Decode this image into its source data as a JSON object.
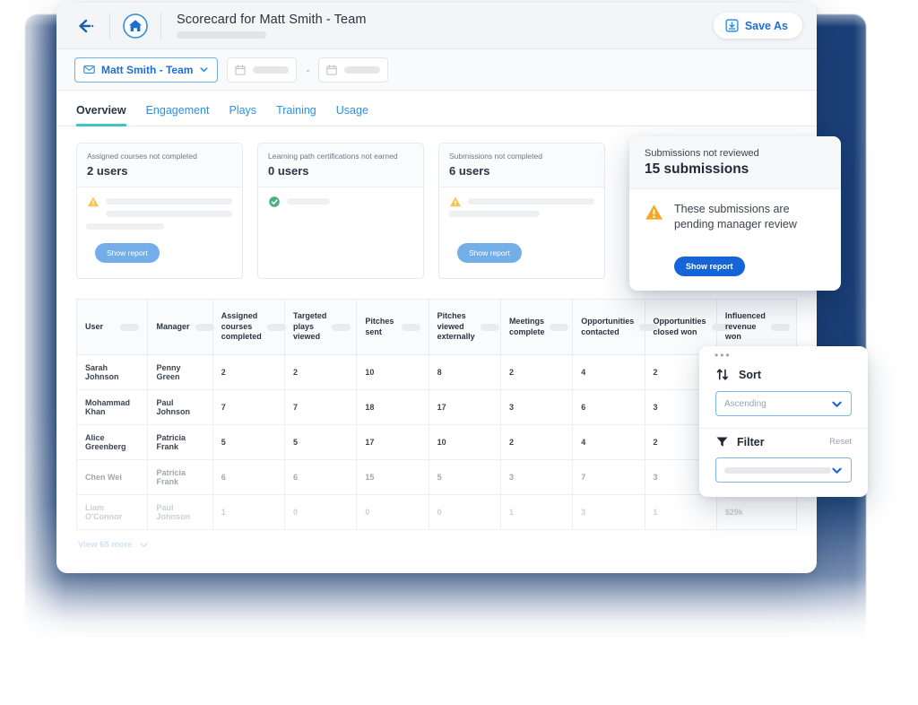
{
  "header": {
    "title": "Scorecard for Matt Smith - Team",
    "back_icon": "arrow-left-icon",
    "home_icon": "home-icon",
    "save_as_label": "Save As",
    "save_as_icon": "save-icon"
  },
  "filter_bar": {
    "audience_chip": {
      "label": "Matt Smith - Team",
      "icon": "envelope-icon",
      "chevron": "chevron-down-icon"
    },
    "date_from": {
      "value": "",
      "icon": "calendar-icon"
    },
    "date_separator": "-",
    "date_to": {
      "value": "",
      "icon": "calendar-icon"
    }
  },
  "tabs": [
    {
      "label": "Overview",
      "active": true
    },
    {
      "label": "Engagement",
      "active": false
    },
    {
      "label": "Plays",
      "active": false
    },
    {
      "label": "Training",
      "active": false
    },
    {
      "label": "Usage",
      "active": false
    }
  ],
  "kpi_cards": [
    {
      "title": "Assigned courses not completed",
      "value": "2 users",
      "status_icon": "warning-triangle-icon",
      "status_color": "#f5b731",
      "button_label": "Show report",
      "skeleton_lines": 3
    },
    {
      "title": "Learning path certifications not earned",
      "value": "0 users",
      "status_icon": "check-circle-icon",
      "status_color": "#4caf7d",
      "button_label": "",
      "skeleton_lines": 1
    },
    {
      "title": "Submissions not completed",
      "value": "6 users",
      "status_icon": "warning-triangle-icon",
      "status_color": "#f5b731",
      "button_label": "Show report",
      "skeleton_lines": 2
    }
  ],
  "submissions_popover": {
    "title": "Submissions not reviewed",
    "value": "15 submissions",
    "icon": "warning-triangle-icon",
    "message": "These submissions are pending manager review",
    "button_label": "Show report"
  },
  "table": {
    "columns": [
      "User",
      "Manager",
      "Assigned courses completed",
      "Targeted plays viewed",
      "Pitches sent",
      "Pitches viewed externally",
      "Meetings complete",
      "Opportunities contacted",
      "Opportunities closed won",
      "Influenced revenue won"
    ],
    "rows": [
      {
        "user": "Sarah Johnson",
        "manager": "Penny Green",
        "assigned_courses_completed": "2",
        "targeted_plays_viewed": "2",
        "pitches_sent": "10",
        "pitches_viewed_externally": "8",
        "meetings_complete": "2",
        "opportunities_contacted": "4",
        "opportunities_closed_won": "2",
        "influenced_revenue_won": ""
      },
      {
        "user": "Mohammad Khan",
        "manager": "Paul Johnson",
        "assigned_courses_completed": "7",
        "targeted_plays_viewed": "7",
        "pitches_sent": "18",
        "pitches_viewed_externally": "17",
        "meetings_complete": "3",
        "opportunities_contacted": "6",
        "opportunities_closed_won": "3",
        "influenced_revenue_won": ""
      },
      {
        "user": "Alice Greenberg",
        "manager": "Patricia Frank",
        "assigned_courses_completed": "5",
        "targeted_plays_viewed": "5",
        "pitches_sent": "17",
        "pitches_viewed_externally": "10",
        "meetings_complete": "2",
        "opportunities_contacted": "4",
        "opportunities_closed_won": "2",
        "influenced_revenue_won": ""
      },
      {
        "user": "Chen Wei",
        "manager": "Patricia Frank",
        "assigned_courses_completed": "6",
        "targeted_plays_viewed": "6",
        "pitches_sent": "15",
        "pitches_viewed_externally": "5",
        "meetings_complete": "3",
        "opportunities_contacted": "7",
        "opportunities_closed_won": "3",
        "influenced_revenue_won": ""
      },
      {
        "user": "Liam O'Connor",
        "manager": "Paul Johnson",
        "assigned_courses_completed": "1",
        "targeted_plays_viewed": "0",
        "pitches_sent": "0",
        "pitches_viewed_externally": "0",
        "meetings_complete": "1",
        "opportunities_contacted": "3",
        "opportunities_closed_won": "1",
        "influenced_revenue_won": "$29k"
      }
    ],
    "view_more_label": "View 65 more",
    "view_more_icon": "chevron-down-icon"
  },
  "sort_filter_popover": {
    "overflow_icon": "ellipsis-icon",
    "sort": {
      "label": "Sort",
      "icon": "sort-arrows-icon",
      "value": "Ascending",
      "chevron": "chevron-down-icon"
    },
    "filter": {
      "label": "Filter",
      "icon": "funnel-icon",
      "reset_label": "Reset",
      "value": "",
      "chevron": "chevron-down-icon"
    }
  },
  "theme": {
    "backdrop_blue": "#1b3f78",
    "link_blue": "#2e8fe0",
    "accent_teal": "#3fc3c6",
    "primary_blue": "#1565d8",
    "warning_amber": "#f5b731",
    "success_green": "#4caf7d"
  }
}
